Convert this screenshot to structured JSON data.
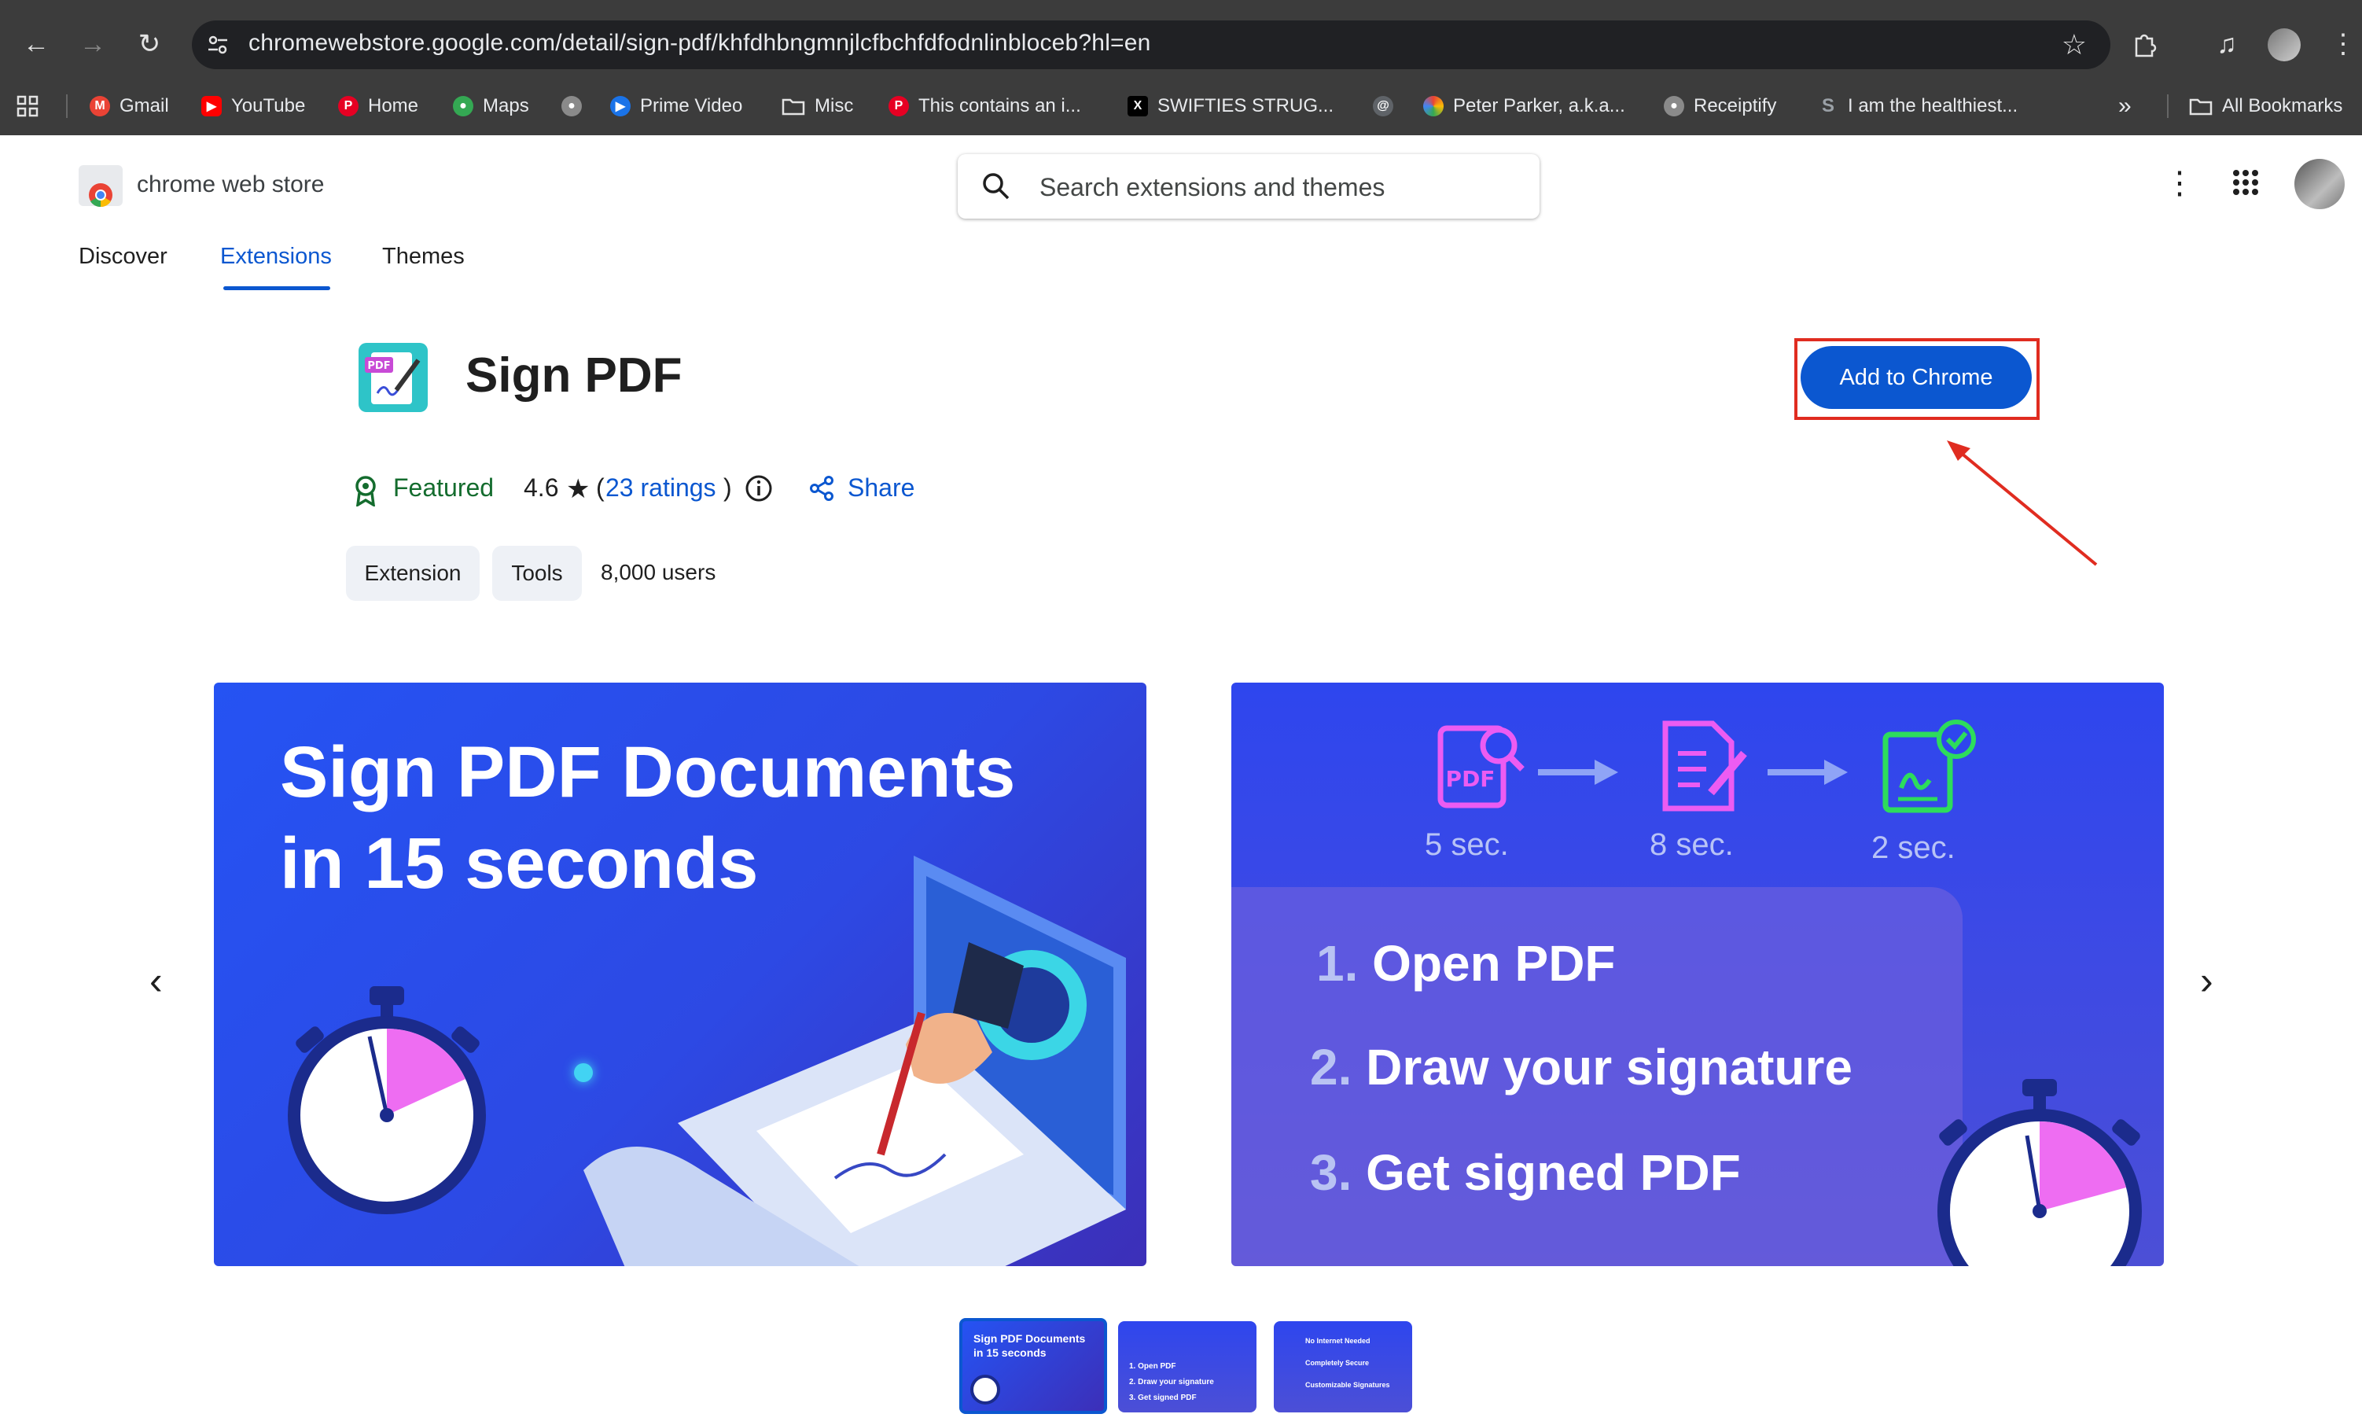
{
  "browser": {
    "url": "chromewebstore.google.com/detail/sign-pdf/khfdhbngmnjlcfbchfdfodnlinbloceb?hl=en",
    "bookmarks": [
      {
        "label": "Gmail",
        "icon": "gmail-icon"
      },
      {
        "label": "YouTube",
        "icon": "youtube-icon"
      },
      {
        "label": "Home",
        "icon": "pinterest-icon"
      },
      {
        "label": "Maps",
        "icon": "maps-icon"
      },
      {
        "label": "",
        "icon": "globe-icon"
      },
      {
        "label": "Prime Video",
        "icon": "prime-video-icon"
      },
      {
        "label": "Misc",
        "icon": "folder-icon"
      },
      {
        "label": "This contains an i...",
        "icon": "pinterest-icon"
      },
      {
        "label": "SWIFTIES STRUG...",
        "icon": "x-icon"
      },
      {
        "label": "",
        "icon": "site-icon"
      },
      {
        "label": "Peter Parker, a.k.a...",
        "icon": "site-icon"
      },
      {
        "label": "Receiptify",
        "icon": "globe-icon"
      },
      {
        "label": "I am the healthiest...",
        "icon": "s-icon"
      }
    ],
    "all_bookmarks": "All Bookmarks"
  },
  "store": {
    "name": "chrome web store",
    "search_placeholder": "Search extensions and themes",
    "tabs": [
      "Discover",
      "Extensions",
      "Themes"
    ],
    "active_tab": "Extensions"
  },
  "item": {
    "title": "Sign PDF",
    "add_button": "Add to Chrome",
    "featured": "Featured",
    "rating": "4.6",
    "ratings_link": "23 ratings",
    "share": "Share",
    "chips": [
      "Extension",
      "Tools"
    ],
    "users": "8,000 users"
  },
  "screenshots": {
    "slide1_heading_line1": "Sign PDF Documents",
    "slide1_heading_line2": "in 15 seconds",
    "slide2_times": [
      "5 sec.",
      "8 sec.",
      "2 sec."
    ],
    "slide2_steps": [
      {
        "num": "1.",
        "text": "Open PDF"
      },
      {
        "num": "2.",
        "text": "Draw your signature"
      },
      {
        "num": "3.",
        "text": "Get signed PDF"
      }
    ]
  },
  "thumbnails": {
    "thumb1_line1": "Sign PDF Documents",
    "thumb1_line2": "in 15 seconds",
    "thumb2_steps": [
      "1. Open PDF",
      "2. Draw your signature",
      "3. Get signed PDF"
    ],
    "thumb3_items": [
      "No Internet Needed",
      "Completely Secure",
      "Customizable Signatures"
    ]
  },
  "colors": {
    "accent": "#0b57d0",
    "featured_green": "#146c2e",
    "highlight_red": "#e02c20"
  }
}
